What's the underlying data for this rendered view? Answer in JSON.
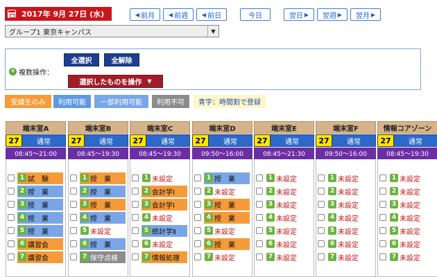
{
  "header": {
    "date": "2017年 9月 27日 (水)",
    "nav": {
      "prev_month": "前月",
      "prev_week": "前週",
      "prev_day": "前日",
      "today": "今日",
      "next_day": "翌日",
      "next_week": "翌週",
      "next_month": "翌月"
    },
    "group_select": "グループ1 東京キャンパス"
  },
  "ops": {
    "label": "複数操作：",
    "select_all": "全選択",
    "deselect_all": "全解除",
    "operate_selected": "選択したものを操作"
  },
  "legend": {
    "students_only": "受講生のみ",
    "available": "利用可能",
    "partial": "一部利用可能",
    "unavailable": "利用不可",
    "note": "青字：時間割で登録"
  },
  "colors": {
    "date_red": "#c8161d",
    "legend_orange": "#f59b3a",
    "legend_blue": "#5e9ae0",
    "legend_partial": "#7aa6e8",
    "legend_gray": "#8c8c8c",
    "room_purple": "#6b2ea4",
    "room_blue": "#2c69c9",
    "day_yellow": "#ffe600"
  },
  "rooms": [
    {
      "name": "端末室A",
      "day": "27",
      "type": "通常",
      "hours": "08:45～21:00",
      "slots": [
        {
          "n": "1",
          "label": "試　験",
          "status": "orange"
        },
        {
          "n": "2",
          "label": "授　業",
          "status": "blue"
        },
        {
          "n": "3",
          "label": "授　業",
          "status": "blue"
        },
        {
          "n": "4",
          "label": "授　業",
          "status": "blue"
        },
        {
          "n": "5",
          "label": "授　業",
          "status": "blue"
        },
        {
          "n": "6",
          "label": "講習会",
          "status": "orange"
        },
        {
          "n": "7",
          "label": "講習会",
          "status": "orange"
        }
      ]
    },
    {
      "name": "端末室B",
      "day": "27",
      "type": "通常",
      "hours": "08:45～19:30",
      "slots": [
        {
          "n": "1",
          "label": "授　業",
          "status": "orange"
        },
        {
          "n": "2",
          "label": "授　業",
          "status": "blue"
        },
        {
          "n": "3",
          "label": "授　業",
          "status": "orange"
        },
        {
          "n": "4",
          "label": "授　業",
          "status": "blue"
        },
        {
          "n": "5",
          "label": "未設定",
          "status": "none"
        },
        {
          "n": "6",
          "label": "授　業",
          "status": "blue"
        },
        {
          "n": "7",
          "label": "保守点検",
          "status": "gray"
        }
      ]
    },
    {
      "name": "端末室C",
      "day": "27",
      "type": "通常",
      "hours": "08:45～19:30",
      "slots": [
        {
          "n": "1",
          "label": "未設定",
          "status": "none"
        },
        {
          "n": "2",
          "label": "会計学Ⅰ",
          "status": "orange"
        },
        {
          "n": "3",
          "label": "会計学Ⅰ",
          "status": "orange"
        },
        {
          "n": "4",
          "label": "未設定",
          "status": "none"
        },
        {
          "n": "5",
          "label": "統計学Ⅱ",
          "status": "blue"
        },
        {
          "n": "6",
          "label": "未設定",
          "status": "none"
        },
        {
          "n": "7",
          "label": "情報処理",
          "status": "orange"
        }
      ]
    },
    {
      "name": "端末室D",
      "day": "27",
      "type": "通常",
      "hours": "09:50～16:00",
      "slots": [
        {
          "n": "1",
          "label": "授　業",
          "status": "blue"
        },
        {
          "n": "2",
          "label": "未設定",
          "status": "none"
        },
        {
          "n": "3",
          "label": "授　業",
          "status": "orange"
        },
        {
          "n": "4",
          "label": "授　業",
          "status": "orange"
        },
        {
          "n": "5",
          "label": "未設定",
          "status": "none"
        },
        {
          "n": "6",
          "label": "授　業",
          "status": "orange"
        },
        {
          "n": "7",
          "label": "未設定",
          "status": "none"
        }
      ]
    },
    {
      "name": "端末室E",
      "day": "27",
      "type": "通常",
      "hours": "08:45～21:30",
      "slots": [
        {
          "n": "1",
          "label": "未設定",
          "status": "none"
        },
        {
          "n": "2",
          "label": "未設定",
          "status": "none"
        },
        {
          "n": "3",
          "label": "未設定",
          "status": "none"
        },
        {
          "n": "4",
          "label": "未設定",
          "status": "none"
        },
        {
          "n": "5",
          "label": "未設定",
          "status": "none"
        },
        {
          "n": "6",
          "label": "未設定",
          "status": "none"
        },
        {
          "n": "7",
          "label": "未設定",
          "status": "none"
        }
      ]
    },
    {
      "name": "端末室F",
      "day": "27",
      "type": "通常",
      "hours": "09:50～16:00",
      "slots": [
        {
          "n": "1",
          "label": "未設定",
          "status": "none"
        },
        {
          "n": "2",
          "label": "未設定",
          "status": "none"
        },
        {
          "n": "3",
          "label": "未設定",
          "status": "none"
        },
        {
          "n": "4",
          "label": "未設定",
          "status": "none"
        },
        {
          "n": "5",
          "label": "未設定",
          "status": "none"
        },
        {
          "n": "6",
          "label": "未設定",
          "status": "none"
        },
        {
          "n": "7",
          "label": "未設定",
          "status": "none"
        }
      ]
    },
    {
      "name": "情報コアゾーン",
      "day": "27",
      "type": "通常",
      "hours": "08:45～19:30",
      "slots": [
        {
          "n": "1",
          "label": "未設定",
          "status": "none"
        },
        {
          "n": "2",
          "label": "未設定",
          "status": "none"
        },
        {
          "n": "3",
          "label": "未設定",
          "status": "none"
        },
        {
          "n": "4",
          "label": "未設定",
          "status": "none"
        },
        {
          "n": "5",
          "label": "未設定",
          "status": "none"
        },
        {
          "n": "6",
          "label": "未設定",
          "status": "none"
        },
        {
          "n": "7",
          "label": "未設定",
          "status": "none"
        }
      ]
    }
  ]
}
